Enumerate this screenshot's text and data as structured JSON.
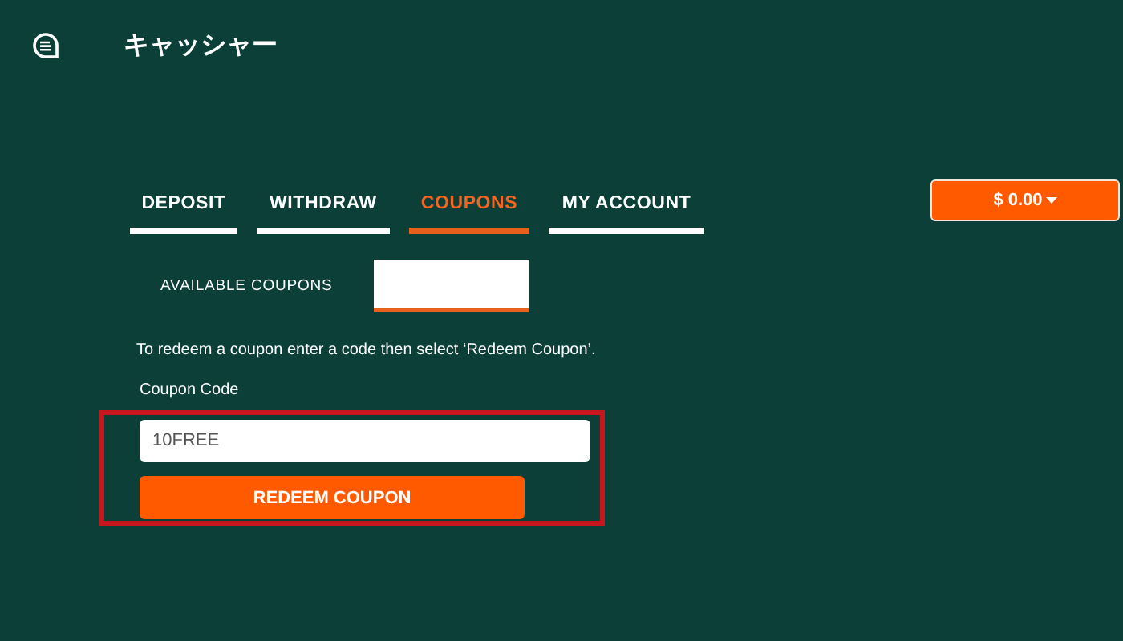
{
  "header": {
    "title": "キャッシャー"
  },
  "tabs": [
    {
      "label": "DEPOSIT",
      "selected": false
    },
    {
      "label": "WITHDRAW",
      "selected": false
    },
    {
      "label": "COUPONS",
      "selected": true
    },
    {
      "label": "MY ACCOUNT",
      "selected": false
    }
  ],
  "balance_button": {
    "label": "$ 0.00"
  },
  "sub_tab": {
    "label": "AVAILABLE COUPONS"
  },
  "instructions": "To redeem a coupon enter a code then select ‘Redeem Coupon’.",
  "coupon_field": {
    "label": "Coupon Code",
    "value": "10FREE"
  },
  "redeem_button": {
    "label": "REDEEM COUPON"
  },
  "highlighted": true
}
